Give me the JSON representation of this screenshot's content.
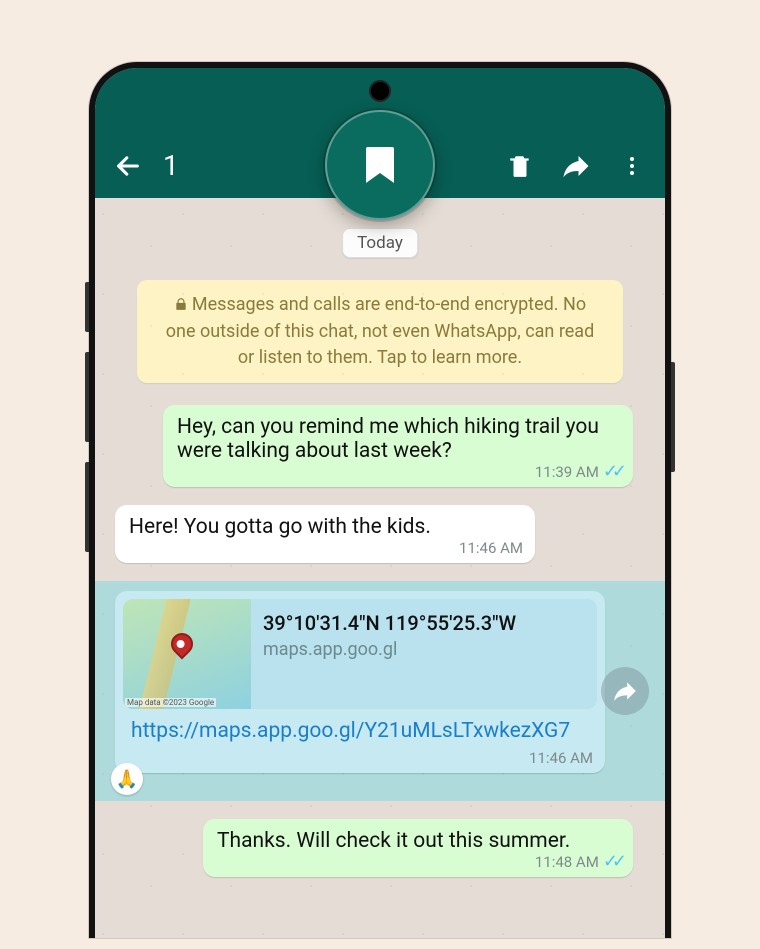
{
  "appbar": {
    "selected_count": "1"
  },
  "date_label": "Today",
  "e2e_notice": "Messages and calls are end-to-end encrypted. No one outside of this chat, not even WhatsApp, can read or listen to them. Tap to learn more.",
  "messages": {
    "m1": {
      "text": "Hey, can you remind me which hiking trail you were talking about last week?",
      "time": "11:39 AM"
    },
    "m2": {
      "text": "Here! You gotta go with the kids.",
      "time": "11:46 AM"
    },
    "m3": {
      "preview_title": "39°10'31.4\"N 119°55'25.3\"W",
      "preview_domain": "maps.app.goo.gl",
      "url": "https://maps.app.goo.gl/Y21uMLsLTxwkezXG7",
      "time": "11:46 AM",
      "map_attr": "Map data ©2023 Google",
      "reaction": "🙏"
    },
    "m4": {
      "text": "Thanks. Will check it out this summer.",
      "time": "11:48 AM"
    }
  }
}
